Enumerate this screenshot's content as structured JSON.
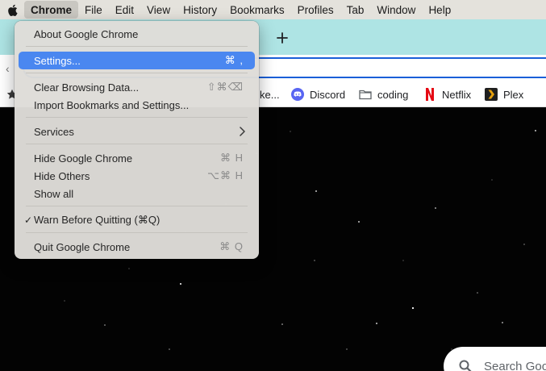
{
  "menubar": {
    "apple_icon": "apple-logo-icon",
    "items": [
      {
        "label": "Chrome"
      },
      {
        "label": "File"
      },
      {
        "label": "Edit"
      },
      {
        "label": "View"
      },
      {
        "label": "History"
      },
      {
        "label": "Bookmarks"
      },
      {
        "label": "Profiles"
      },
      {
        "label": "Tab"
      },
      {
        "label": "Window"
      },
      {
        "label": "Help"
      }
    ]
  },
  "browser": {
    "tab_strip_color": "#aee4e4",
    "new_tab_icon": "plus-icon",
    "omnibox_border_color": "#1a5fd8",
    "bookmarks": [
      {
        "label": "ke...",
        "icon": "none"
      },
      {
        "label": "Discord",
        "icon": "discord-icon"
      },
      {
        "label": "coding",
        "icon": "folder-icon"
      },
      {
        "label": "Netflix",
        "icon": "netflix-icon"
      },
      {
        "label": "Plex",
        "icon": "plex-icon"
      }
    ]
  },
  "page": {
    "search_placeholder": "Search Goo"
  },
  "chrome_menu": {
    "highlight_color": "#4a87f0",
    "items": [
      {
        "label": "About Google Chrome",
        "shortcut": ""
      },
      {
        "label": "Settings...",
        "shortcut": "⌘ ,"
      },
      {
        "label": "Clear Browsing Data...",
        "shortcut": "⇧⌘⌫"
      },
      {
        "label": "Import Bookmarks and Settings...",
        "shortcut": ""
      },
      {
        "label": "Services",
        "shortcut": ""
      },
      {
        "label": "Hide Google Chrome",
        "shortcut": "⌘ H"
      },
      {
        "label": "Hide Others",
        "shortcut": "⌥⌘ H"
      },
      {
        "label": "Show all",
        "shortcut": ""
      },
      {
        "label": "Warn Before Quitting (⌘Q)",
        "shortcut": ""
      },
      {
        "label": "Quit Google Chrome",
        "shortcut": "⌘ Q"
      }
    ]
  }
}
